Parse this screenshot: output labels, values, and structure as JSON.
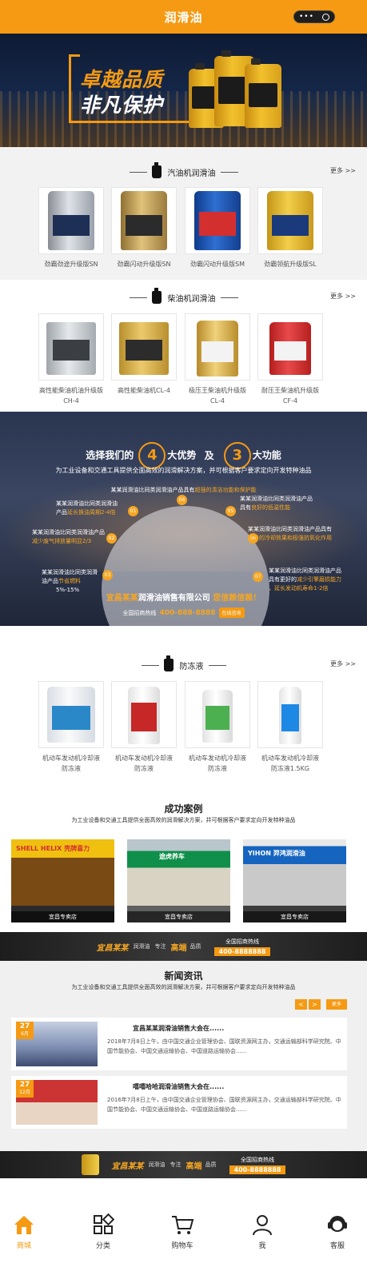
{
  "header": {
    "title": "润滑油"
  },
  "banner": {
    "slogan_1": "卓越品质",
    "slogan_2": "非凡保护"
  },
  "sections": {
    "gasoline": {
      "title": "汽油机润滑油",
      "more": "更多 >>",
      "products": [
        {
          "name": "劲霸劲途升级版SN"
        },
        {
          "name": "劲霸闪动升级版SN"
        },
        {
          "name": "劲霸闪动升级版SM"
        },
        {
          "name": "劲霸领航升级版SL"
        }
      ]
    },
    "diesel": {
      "title": "柴油机润滑油",
      "more": "更多 >>",
      "products": [
        {
          "name": "高性能柴油机油升级版",
          "name2": "CH-4"
        },
        {
          "name": "高性能柴油机CL-4",
          "name2": ""
        },
        {
          "name": "极压王柴油机升级版",
          "name2": "CL-4"
        },
        {
          "name": "耐压王柴油机升级版",
          "name2": "CF-4"
        }
      ]
    },
    "antifreeze": {
      "title": "防冻液",
      "more": "更多 >>",
      "products": [
        {
          "name": "机动车发动机冷却液",
          "name2": "防冻液"
        },
        {
          "name": "机动车发动机冷却液",
          "name2": "防冻液"
        },
        {
          "name": "机动车发动机冷却液",
          "name2": "防冻液"
        },
        {
          "name": "机动车发动机冷却液",
          "name2": "防冻液1.5KG"
        }
      ]
    }
  },
  "advantages": {
    "pre": "选择我们的",
    "num1": "4",
    "mid1": "大优势",
    "and": "及",
    "num2": "3",
    "mid2": "大功能",
    "sub": "为工业设备和交通工具提供全面高效的润滑解决方案，并可根据客户要求定向开发特种油品",
    "intro_a": "某某润滑油比同类润滑油产品具有",
    "intro_hl": "超强的清洁功能和保护能",
    "point_1a": "某某润滑油比同类润滑油",
    "point_1b": "产品",
    "point_1hl": "延长换油周期2-4倍",
    "point_2a": "某某润滑油比同类润滑油产品",
    "point_2hl": "减少废气排放量明显2/3",
    "point_3a": "某某润滑油比同类润滑",
    "point_3b": "油产品",
    "point_3hl": "节省燃料",
    "point_3c": "5%-15%",
    "point_4a": "某某润滑油比同类润滑油产品",
    "point_4b": "具有",
    "point_4hl": "良好的低温性能",
    "point_5a": "某某润滑油比同类润滑油产品具有",
    "point_5hl": "优异的冷却效果和极强抗氧化作用",
    "point_6a": "某某润滑油比同类润滑油产品",
    "point_6b": "具有更好的",
    "point_6hl": "减少引擎磨损能力",
    "point_6c": "，延长发动机寿命1-2倍",
    "hot_brand": "宜昌某某",
    "hot_text": "润滑油销售有限公司",
    "hot_end": "您信赖信赖！",
    "hotline_label": "全国招商热线",
    "hotline": "400-888-8888",
    "hotline_btn": "在线咨询"
  },
  "cases": {
    "title": "成功案例",
    "sub": "为工业设备和交通工具提供全面高效的润滑解决方案，并可根据客户要求定向开发特种油品",
    "items": [
      {
        "caption": "宜昌专卖店",
        "sign": "SHELL HELIX 壳牌喜力"
      },
      {
        "caption": "宜昌专卖店",
        "sign": "途虎养车"
      },
      {
        "caption": "宜昌专卖店",
        "sign": "YIHON 羿鸿润滑油"
      }
    ]
  },
  "hotbar": {
    "brand": "宜昌某某",
    "small": "润滑油",
    "focus": "专注",
    "gold": "高端",
    "quality": "品质",
    "label": "全国招商热线",
    "number": "400-8888888"
  },
  "news": {
    "title": "新闻资讯",
    "sub": "为工业设备和交通工具提供全面高效的润滑解决方案，并可根据客户要求定向开发特种油品",
    "more": "更多",
    "prev": "<",
    "next": ">",
    "items": [
      {
        "day": "27",
        "month": "6月",
        "title": "宜昌某某润滑油销售大会在......",
        "desc": "2018年7月8日上午，由中国交通企业管理协会、国联资源网主办，交通运输部科学研究院、中国节能协会、中国交通运输协会、中国道路运输协会......"
      },
      {
        "day": "27",
        "month": "12月",
        "title": "嘻嘻哈哈润滑油销售大会在......",
        "desc": "2016年7月8日上午，由中国交通企业管理协会、国联资源网主办，交通运输部科学研究院、中国节能协会、中国交通运输协会、中国道路运输协会......"
      }
    ]
  },
  "tabbar": {
    "items": [
      {
        "label": "商城"
      },
      {
        "label": "分类"
      },
      {
        "label": "购物车"
      },
      {
        "label": "我"
      },
      {
        "label": "客服"
      }
    ]
  },
  "colors": {
    "accent": "#f59a12",
    "dark": "#222222"
  }
}
